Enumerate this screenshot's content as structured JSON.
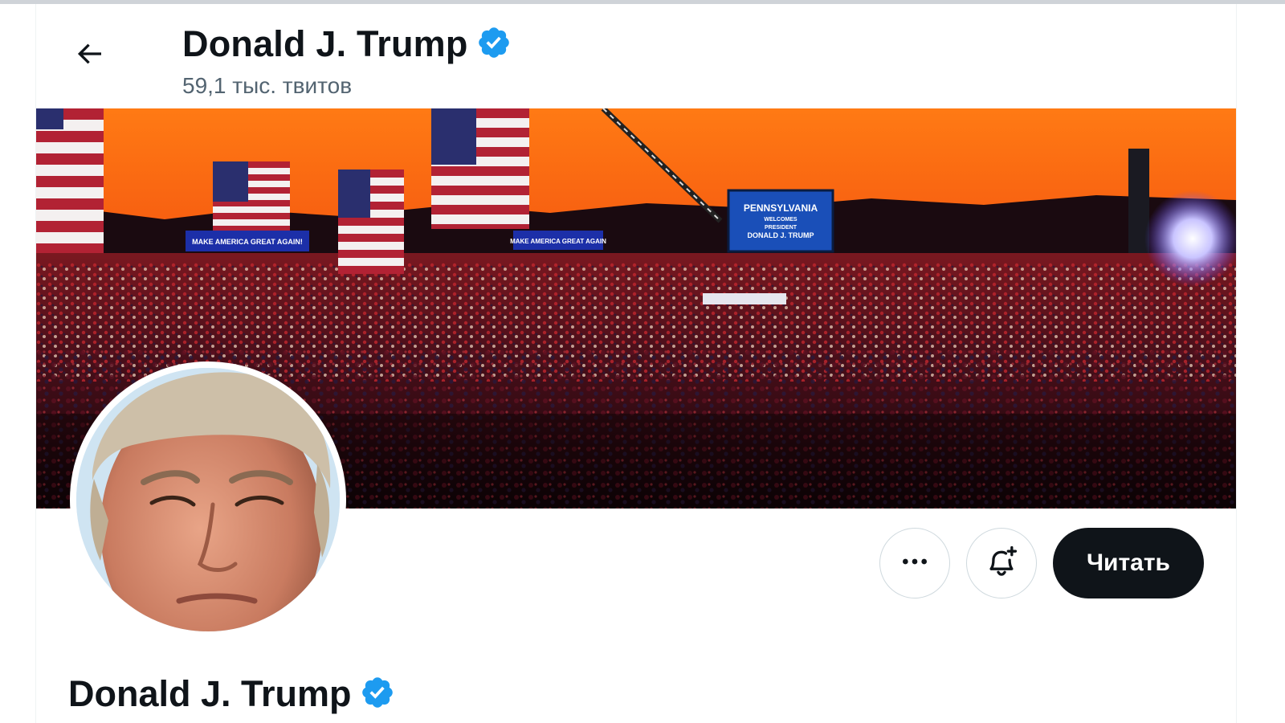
{
  "header": {
    "back_icon": "arrow-left-icon",
    "title": "Donald J. Trump",
    "verified_icon": "verified-badge-icon",
    "tweet_count": "59,1 тыс. твитов"
  },
  "banner": {
    "description_icon": "rally-banner-image",
    "sign_text": [
      "PENNSYLVANIA",
      "WELCOMES",
      "PRESIDENT",
      "DONALD J. TRUMP"
    ],
    "banner_left_text": "MAKE AMERICA GREAT AGAIN!",
    "banner_mid_text": "MAKE AMERICA GREAT AGAIN"
  },
  "avatar": {
    "icon": "profile-avatar-image"
  },
  "actions": {
    "more_icon": "more-horizontal-icon",
    "notify_icon": "bell-plus-icon",
    "follow_label": "Читать"
  },
  "profile": {
    "name": "Donald J. Trump",
    "verified_icon": "verified-badge-icon"
  },
  "colors": {
    "verified": "#1d9bf0",
    "text_primary": "#0f1419",
    "text_secondary": "#536471",
    "follow_bg": "#0f1419"
  }
}
